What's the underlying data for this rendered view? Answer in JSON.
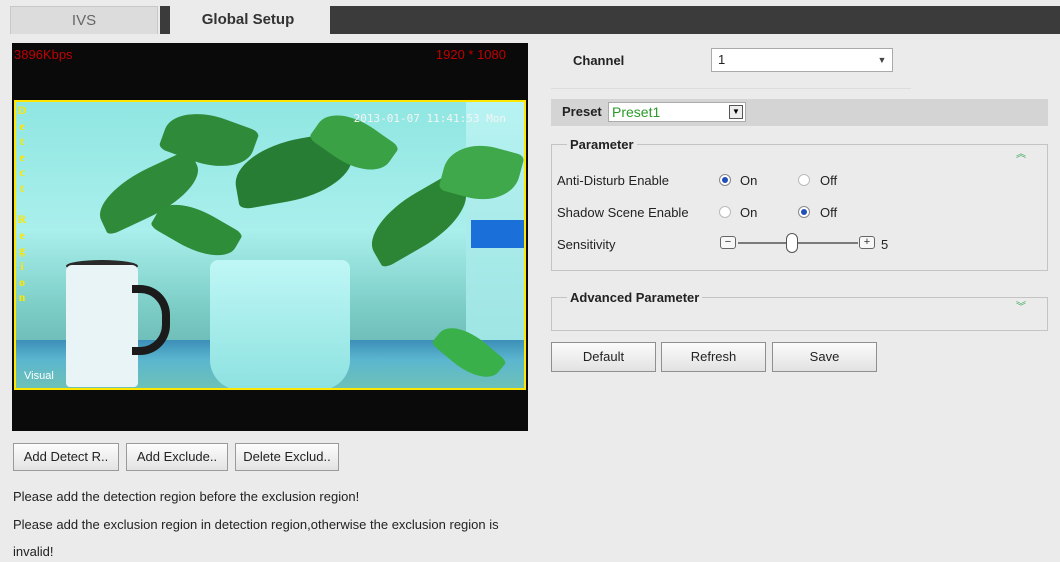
{
  "tabs": [
    {
      "label": "IVS"
    },
    {
      "label": "Global Setup"
    }
  ],
  "video": {
    "bitrate": "3896Kbps",
    "resolution": "1920 * 1080",
    "timestamp": "2013-01-07 11:41:53 Mon",
    "region_label": [
      "D",
      "e",
      "t",
      "e",
      "c",
      "t",
      "",
      "R",
      "e",
      "g",
      "i",
      "o",
      "n"
    ],
    "visual_tag": "Visual"
  },
  "video_buttons": {
    "add_detect": "Add Detect R..",
    "add_exclude": "Add Exclude..",
    "delete_exclude": "Delete Exclud.."
  },
  "notes": [
    "Please add the detection region before the exclusion region!",
    "Please add the exclusion region in detection region,otherwise the exclusion region is",
    "invalid!"
  ],
  "channel": {
    "label": "Channel",
    "value": "1"
  },
  "preset": {
    "label": "Preset",
    "value": "Preset1"
  },
  "parameter": {
    "title": "Parameter",
    "anti_disturb": {
      "label": "Anti-Disturb Enable",
      "on": "On",
      "off": "Off",
      "selected": "on"
    },
    "shadow_scene": {
      "label": "Shadow Scene Enable",
      "on": "On",
      "off": "Off",
      "selected": "off"
    },
    "sensitivity": {
      "label": "Sensitivity",
      "value": "5",
      "minus": "−",
      "plus": "+"
    }
  },
  "advanced": {
    "title": "Advanced Parameter"
  },
  "actions": {
    "default": "Default",
    "refresh": "Refresh",
    "save": "Save"
  },
  "icons": {
    "collapse": "double-chevron-up-icon",
    "expand": "double-chevron-down-icon",
    "dropdown": "chevron-down-icon"
  },
  "colors": {
    "accent_green": "#2a9a2a",
    "osd_red": "#c00000",
    "region_yellow": "#ffe600",
    "radio_blue": "#1f4fb8"
  }
}
